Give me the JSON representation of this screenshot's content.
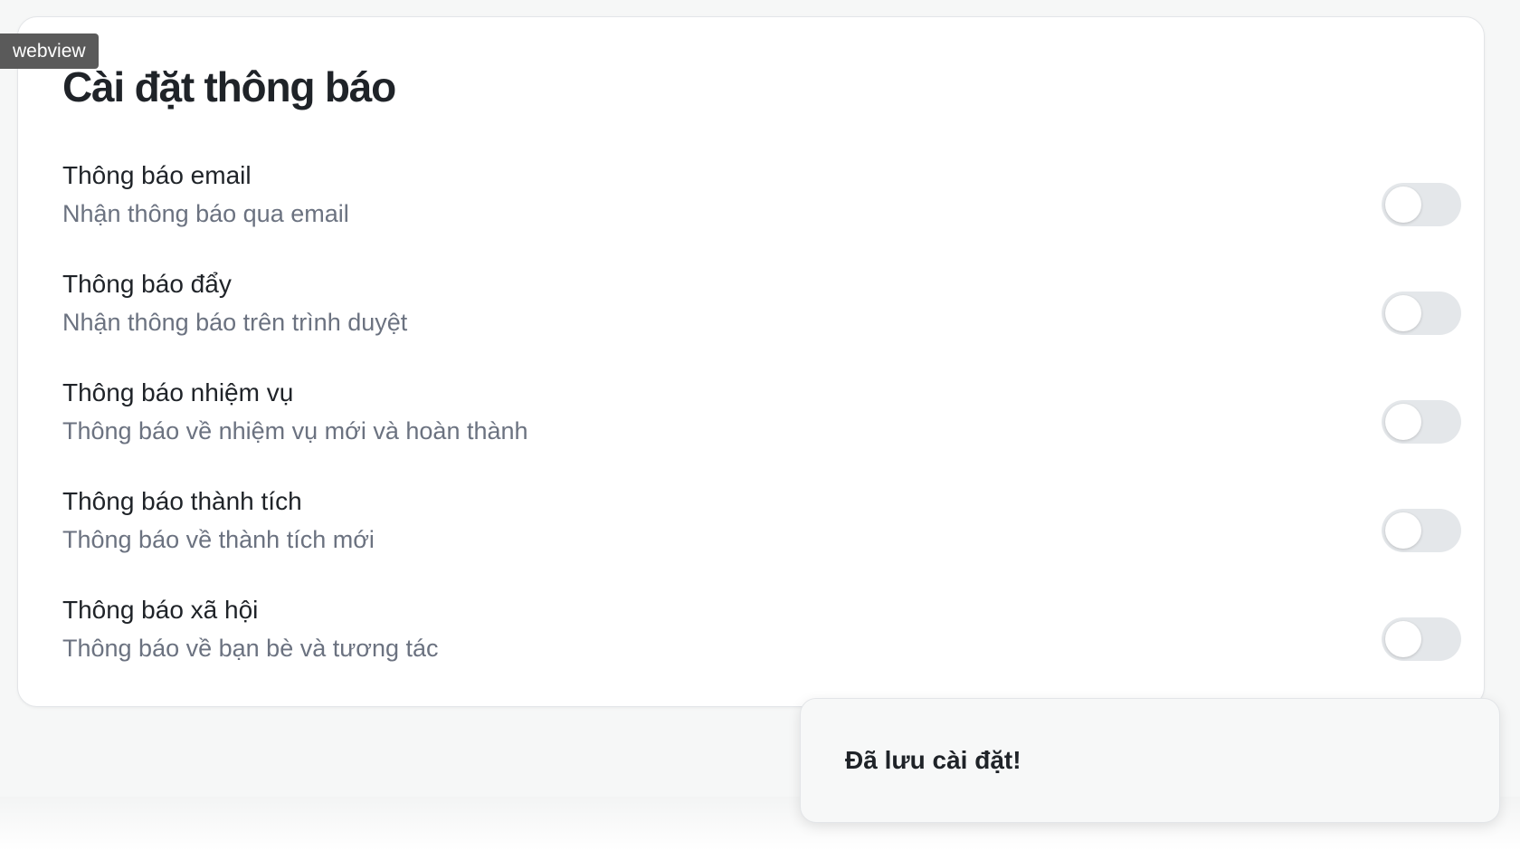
{
  "tab_label": "webview",
  "page": {
    "title": "Cài đặt thông báo"
  },
  "settings": [
    {
      "title": "Thông báo email",
      "description": "Nhận thông báo qua email",
      "enabled": false
    },
    {
      "title": "Thông báo đẩy",
      "description": "Nhận thông báo trên trình duyệt",
      "enabled": false
    },
    {
      "title": "Thông báo nhiệm vụ",
      "description": "Thông báo về nhiệm vụ mới và hoàn thành",
      "enabled": false
    },
    {
      "title": "Thông báo thành tích",
      "description": "Thông báo về thành tích mới",
      "enabled": false
    },
    {
      "title": "Thông báo xã hội",
      "description": "Thông báo về bạn bè và tương tác",
      "enabled": false
    }
  ],
  "toast": {
    "message": "Đã lưu cài đặt!"
  },
  "colors": {
    "toggle_off": "#e4e7ea",
    "description_text": "#6b7280",
    "background": "#f6f7f7"
  }
}
